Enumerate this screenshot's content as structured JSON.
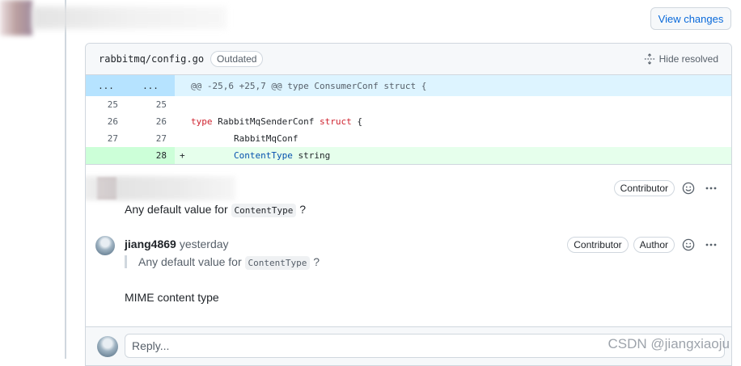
{
  "header": {
    "view_changes_label": "View changes"
  },
  "file": {
    "path": "rabbitmq/config.go",
    "outdated_label": "Outdated",
    "hide_resolved_label": "Hide resolved"
  },
  "diff": {
    "hunk": {
      "left": "...",
      "right": "...",
      "text": "@@ -25,6 +25,7 @@ type ConsumerConf struct {"
    },
    "lines": [
      {
        "old": "25",
        "new": "25",
        "sign": "",
        "code": ""
      },
      {
        "old": "26",
        "new": "26",
        "sign": "",
        "kw1": "type",
        "name": " RabbitMqSenderConf ",
        "kw2": "struct",
        "rest": " {"
      },
      {
        "old": "27",
        "new": "27",
        "sign": "",
        "indent": "        ",
        "code": "RabbitMqConf"
      },
      {
        "old": "",
        "new": "28",
        "sign": "+",
        "indent": "        ",
        "field": "ContentType",
        "rest": " string"
      }
    ]
  },
  "comment1": {
    "badge": "Contributor",
    "text_before": "Any default value for ",
    "code": "ContentType",
    "text_after": " ?"
  },
  "comment2": {
    "author": "jiang4869",
    "time": "yesterday",
    "badge1": "Contributor",
    "badge2": "Author",
    "quote_before": "Any default value for ",
    "quote_code": "ContentType",
    "quote_after": " ?",
    "body": "MIME content type"
  },
  "reply": {
    "placeholder": "Reply..."
  },
  "watermark": "CSDN @jiangxiaoju",
  "icons": {
    "emoji": "smiley-icon",
    "more": "kebab-horizontal-icon",
    "unfold": "unfold-icon"
  }
}
